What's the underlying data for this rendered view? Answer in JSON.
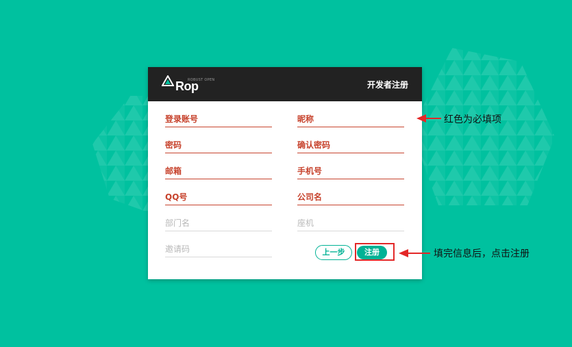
{
  "brand": {
    "logo_text": "Rop",
    "logo_small": "ROBUST OPEN",
    "accent": "#00c19f",
    "required_color": "#c7432d",
    "arrow_color": "#e32727"
  },
  "header": {
    "title": "开发者注册"
  },
  "form": {
    "login_account": "登录账号",
    "nickname": "昵称",
    "password": "密码",
    "confirm_password": "确认密码",
    "email": "邮箱",
    "phone": "手机号",
    "qq": "QQ号",
    "company": "公司名",
    "department": "部门名",
    "landline": "座机",
    "invite_code": "邀请码"
  },
  "buttons": {
    "prev": "上一步",
    "register": "注册"
  },
  "annotations": {
    "required_note": "红色为必填项",
    "register_note": "填完信息后，点击注册"
  }
}
